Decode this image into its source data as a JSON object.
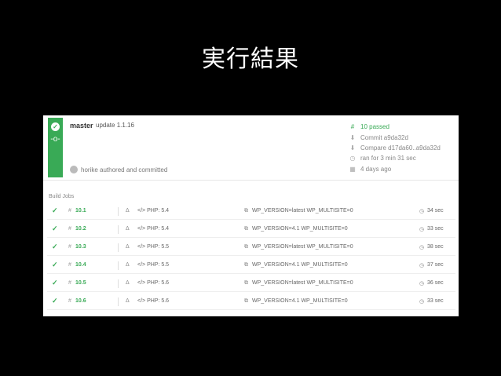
{
  "slide": {
    "title": "実行結果"
  },
  "build": {
    "branch": "master",
    "message": "update 1.1.16",
    "author": "horike authored and committed",
    "meta": [
      {
        "icon": "hash-icon",
        "glyph": "#",
        "text": "10 passed",
        "kind": "passed"
      },
      {
        "icon": "commit-icon",
        "glyph": "⬇",
        "text": "Commit a9da32d"
      },
      {
        "icon": "compare-icon",
        "glyph": "⬇",
        "text": "Compare d17da60..a9da32d"
      },
      {
        "icon": "clock-icon",
        "glyph": "◷",
        "text": "ran for 3 min 31 sec"
      },
      {
        "icon": "calendar-icon",
        "glyph": "▦",
        "text": "4 days ago"
      }
    ]
  },
  "jobs_header": "Build Jobs",
  "jobs": [
    {
      "number": "10.1",
      "lang": "</> PHP: 5.4",
      "env": "WP_VERSION=latest WP_MULTISITE=0",
      "duration": "34 sec"
    },
    {
      "number": "10.2",
      "lang": "</> PHP: 5.4",
      "env": "WP_VERSION=4.1 WP_MULTISITE=0",
      "duration": "33 sec"
    },
    {
      "number": "10.3",
      "lang": "</> PHP: 5.5",
      "env": "WP_VERSION=latest WP_MULTISITE=0",
      "duration": "38 sec"
    },
    {
      "number": "10.4",
      "lang": "</> PHP: 5.5",
      "env": "WP_VERSION=4.1 WP_MULTISITE=0",
      "duration": "37 sec"
    },
    {
      "number": "10.5",
      "lang": "</> PHP: 5.6",
      "env": "WP_VERSION=latest WP_MULTISITE=0",
      "duration": "36 sec"
    },
    {
      "number": "10.6",
      "lang": "</> PHP: 5.6",
      "env": "WP_VERSION=4.1 WP_MULTISITE=0",
      "duration": "33 sec"
    }
  ],
  "colors": {
    "passed": "#39aa56",
    "background": "#000000"
  }
}
